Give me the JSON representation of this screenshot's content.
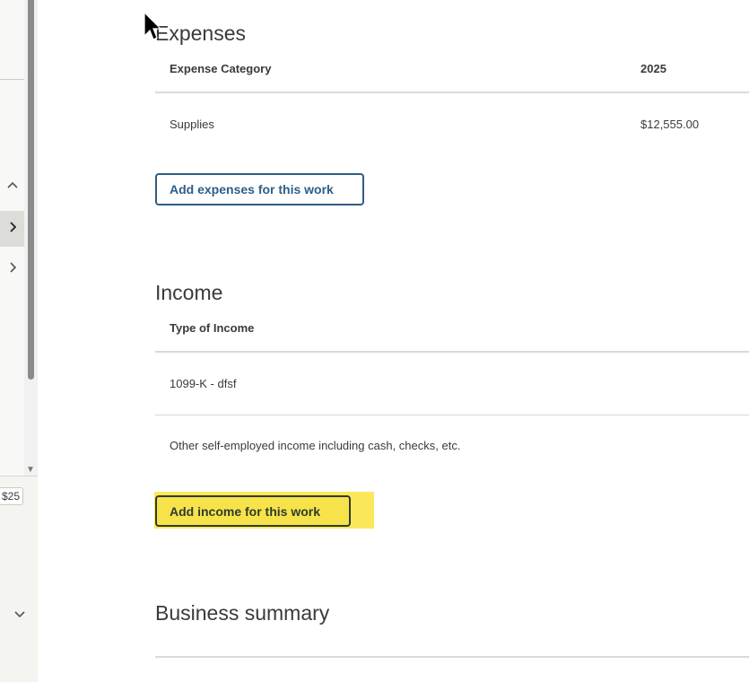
{
  "sidebar": {
    "items": [
      {
        "icon": "chevron-up-icon",
        "glyph": "^"
      },
      {
        "icon": "chevron-right-icon",
        "glyph": ">",
        "active": true
      },
      {
        "icon": "chevron-right-icon",
        "glyph": ">"
      }
    ],
    "price_chip": "$25",
    "bottom_icon": "chevron-down-icon"
  },
  "expenses": {
    "title": "Expenses",
    "col_category": "Expense Category",
    "col_year": "2025",
    "rows": [
      {
        "category": "Supplies",
        "amount": "$12,555.00"
      }
    ],
    "add_button": "Add expenses for this work"
  },
  "income": {
    "title": "Income",
    "col_type": "Type of Income",
    "rows": [
      {
        "type": "1099-K - dfsf"
      },
      {
        "type": "Other self-employed income including cash, checks, etc."
      }
    ],
    "add_button": "Add income for this work"
  },
  "summary": {
    "title": "Business summary"
  },
  "colors": {
    "accent": "#2d5d87",
    "highlight": "#fbe85a"
  }
}
